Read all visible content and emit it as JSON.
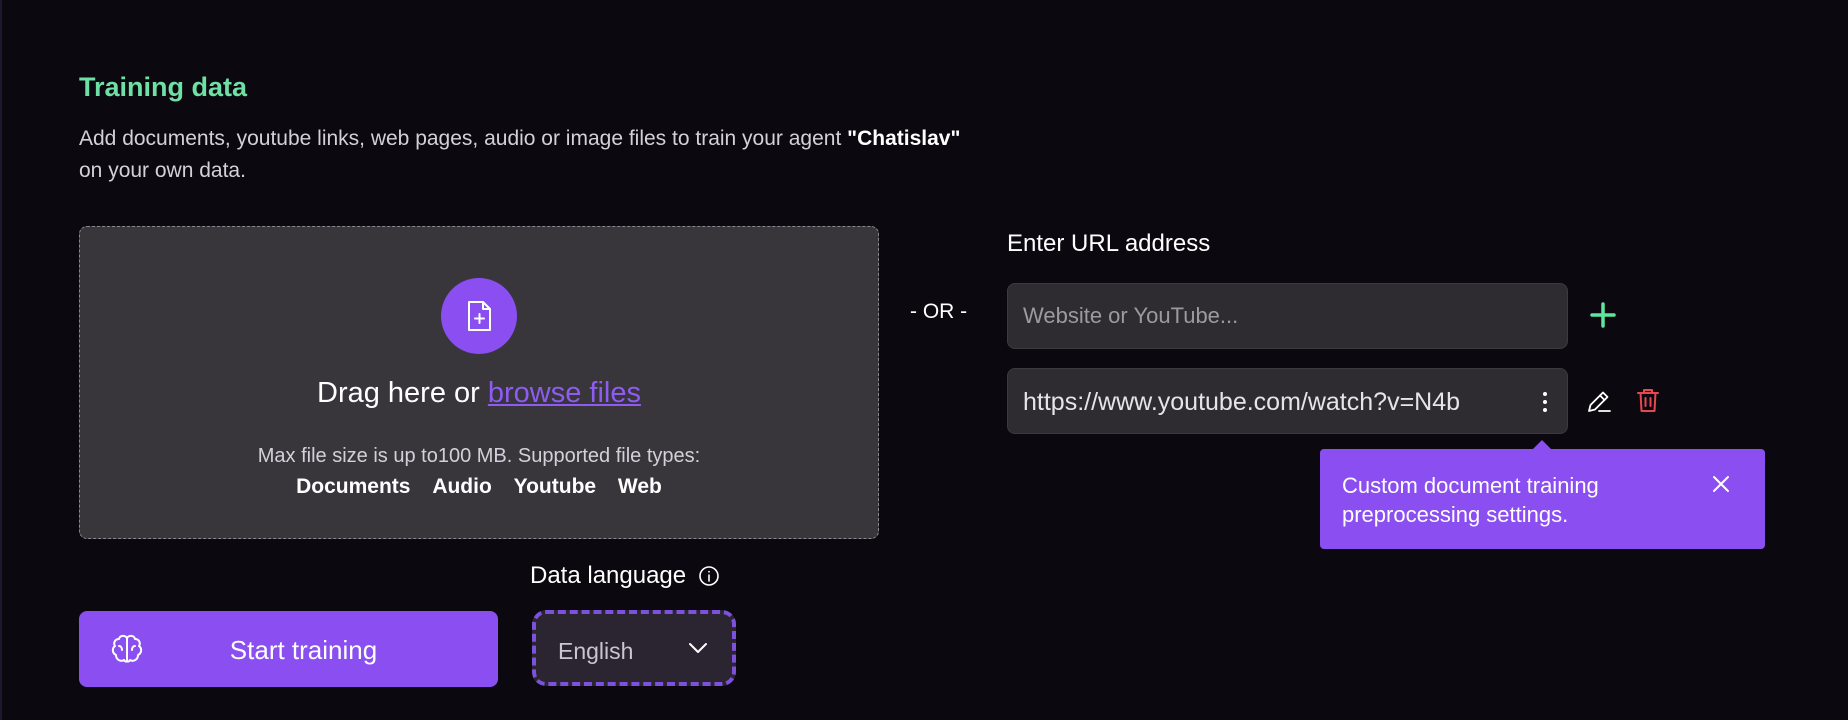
{
  "header": {
    "title": "Training data",
    "description_prefix": "Add documents, youtube links, web pages, audio or image files to train your agent ",
    "agent_name": "\"Chatislav\"",
    "description_suffix": "on your own data."
  },
  "dropzone": {
    "icon": "file-plus-icon",
    "drag_text": "Drag here or ",
    "browse_link": "browse files",
    "max_size_text": "Max file size is up to100 MB. Supported file types:",
    "file_types": [
      "Documents",
      "Audio",
      "Youtube",
      "Web"
    ]
  },
  "separator": "- OR -",
  "url": {
    "label": "Enter URL address",
    "placeholder": "Website or YouTube...",
    "add_icon": "plus-icon",
    "items": [
      {
        "url": "https://www.youtube.com/watch?v=N4b"
      }
    ]
  },
  "tooltip": {
    "text": "Custom document training preprocessing settings.",
    "close_icon": "close-icon"
  },
  "language": {
    "label": "Data language",
    "selected": "English"
  },
  "actions": {
    "start_label": "Start training",
    "start_icon": "brain-icon"
  },
  "colors": {
    "accent": "#8a4ef1",
    "title_green": "#6ee0a6",
    "plus_green": "#5ee6a0",
    "delete_red": "#e5484d",
    "background": "#0b080f"
  }
}
